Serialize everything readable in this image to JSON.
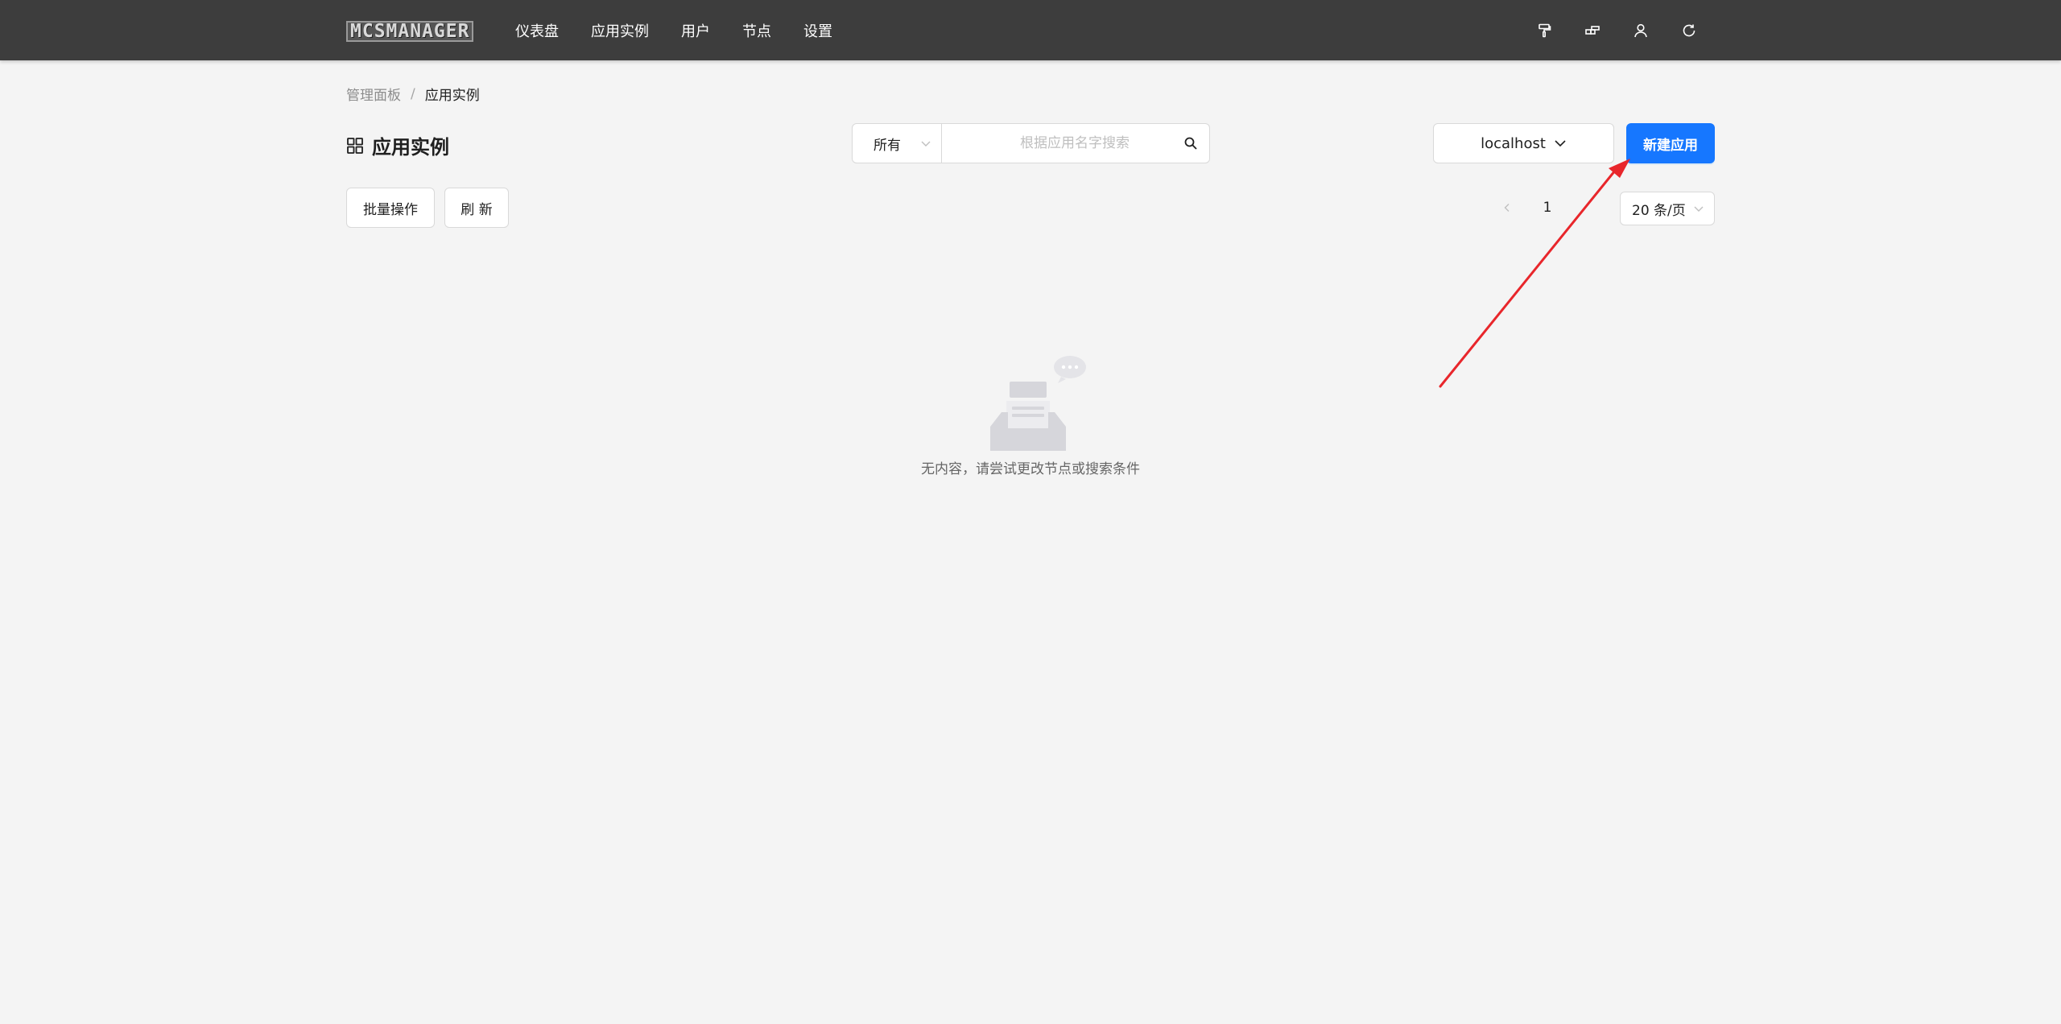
{
  "header": {
    "logo": "MCSMANAGER",
    "nav": [
      "仪表盘",
      "应用实例",
      "用户",
      "节点",
      "设置"
    ],
    "icons": [
      "paint-roller-icon",
      "layout-icon",
      "user-icon",
      "reload-icon"
    ]
  },
  "breadcrumb": {
    "parent": "管理面板",
    "separator": "/",
    "current": "应用实例"
  },
  "page": {
    "title": "应用实例"
  },
  "filter": {
    "status_value": "所有",
    "search_placeholder": "根据应用名字搜索",
    "search_value": ""
  },
  "node_select": {
    "value": "localhost"
  },
  "actions": {
    "create_label": "新建应用",
    "batch_label": "批量操作",
    "refresh_label": "刷 新"
  },
  "pagination": {
    "current_page": "1",
    "page_size": "20 条/页"
  },
  "empty": {
    "message": "无内容，请尝试更改节点或搜索条件"
  },
  "colors": {
    "topbar": "#3d3d3d",
    "background": "#f4f4f4",
    "primary": "#1677ff",
    "annotation_arrow": "#e8262b"
  }
}
